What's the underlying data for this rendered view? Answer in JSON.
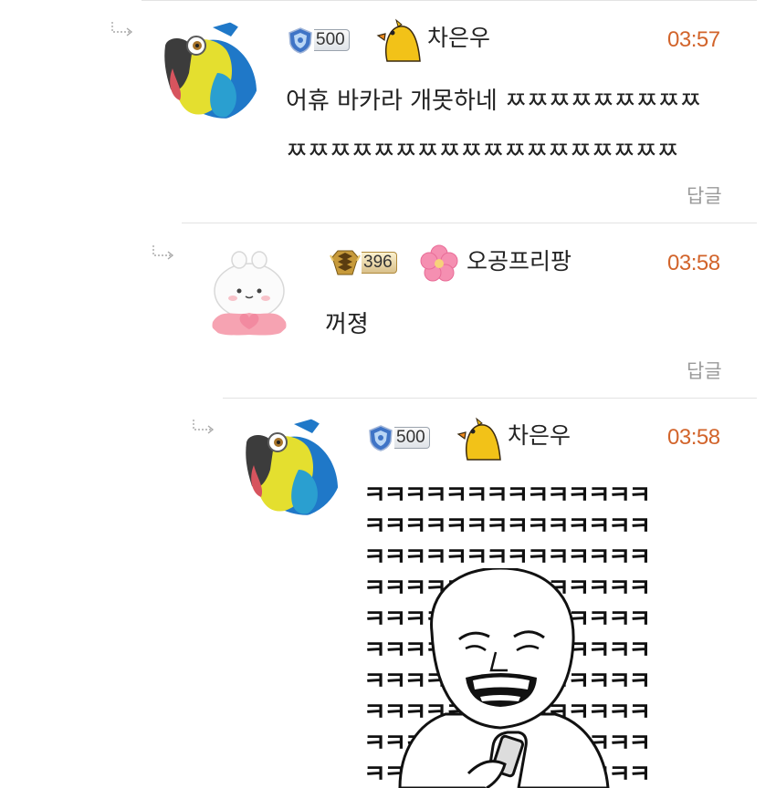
{
  "comments": [
    {
      "level": "500",
      "nickname": "차은우",
      "time": "03:57",
      "text_lines": [
        "어휴 바카라 개못하네 ㅉㅉㅉㅉㅉㅉㅉㅉㅉ",
        "ㅉㅉㅉㅉㅉㅉㅉㅉㅉㅉㅉㅉㅉㅉㅉㅉㅉㅉ"
      ],
      "reply_label": "답글"
    },
    {
      "level": "396",
      "nickname": "오공프리팡",
      "time": "03:58",
      "text_lines": [
        "꺼졍"
      ],
      "reply_label": "답글"
    },
    {
      "level": "500",
      "nickname": "차은우",
      "time": "03:58",
      "sticker_rows": [
        "ㅋㅋㅋㅋㅋㅋㅋㅋㅋㅋㅋㅋㅋㅋ",
        "ㅋㅋㅋㅋㅋㅋㅋㅋㅋㅋㅋㅋㅋㅋ",
        "ㅋㅋㅋㅋㅋㅋㅋㅋㅋㅋㅋㅋㅋㅋ",
        "ㅋㅋㅋㅋㅋㅋㅋㅋㅋㅋㅋㅋㅋㅋ",
        "ㅋㅋㅋㅋㅋㅋㅋㅋㅋㅋㅋㅋㅋㅋ",
        "ㅋㅋㅋㅋㅋㅋㅋㅋㅋㅋㅋㅋㅋㅋ",
        "ㅋㅋㅋㅋㅋㅋㅋㅋㅋㅋㅋㅋㅋㅋ",
        "ㅋㅋㅋㅋㅋㅋㅋㅋㅋㅋㅋㅋㅋㅋ",
        "ㅋㅋㅋㅋㅋㅋㅋㅋㅋㅋㅋㅋㅋㅋ",
        "ㅋㅋㅋㅋㅋㅋㅋㅋㅋㅋㅋㅋㅋㅋ"
      ]
    }
  ],
  "icons": {
    "reply_arrow": "reply-arrow-icon",
    "avatar_1": "parrot-avatar",
    "avatar_2": "white-blob-character-avatar",
    "avatar_3": "parrot-avatar",
    "level_badge_blue": "blue-shield-level-icon",
    "level_badge_gold": "gold-chevron-level-icon",
    "emoticon_bird": "yellow-bird-icon",
    "emoticon_flower": "pink-flower-icon"
  },
  "colors": {
    "time": "#d2642b",
    "reply_link": "#9a9a9a",
    "divider": "#e3e3e3"
  }
}
